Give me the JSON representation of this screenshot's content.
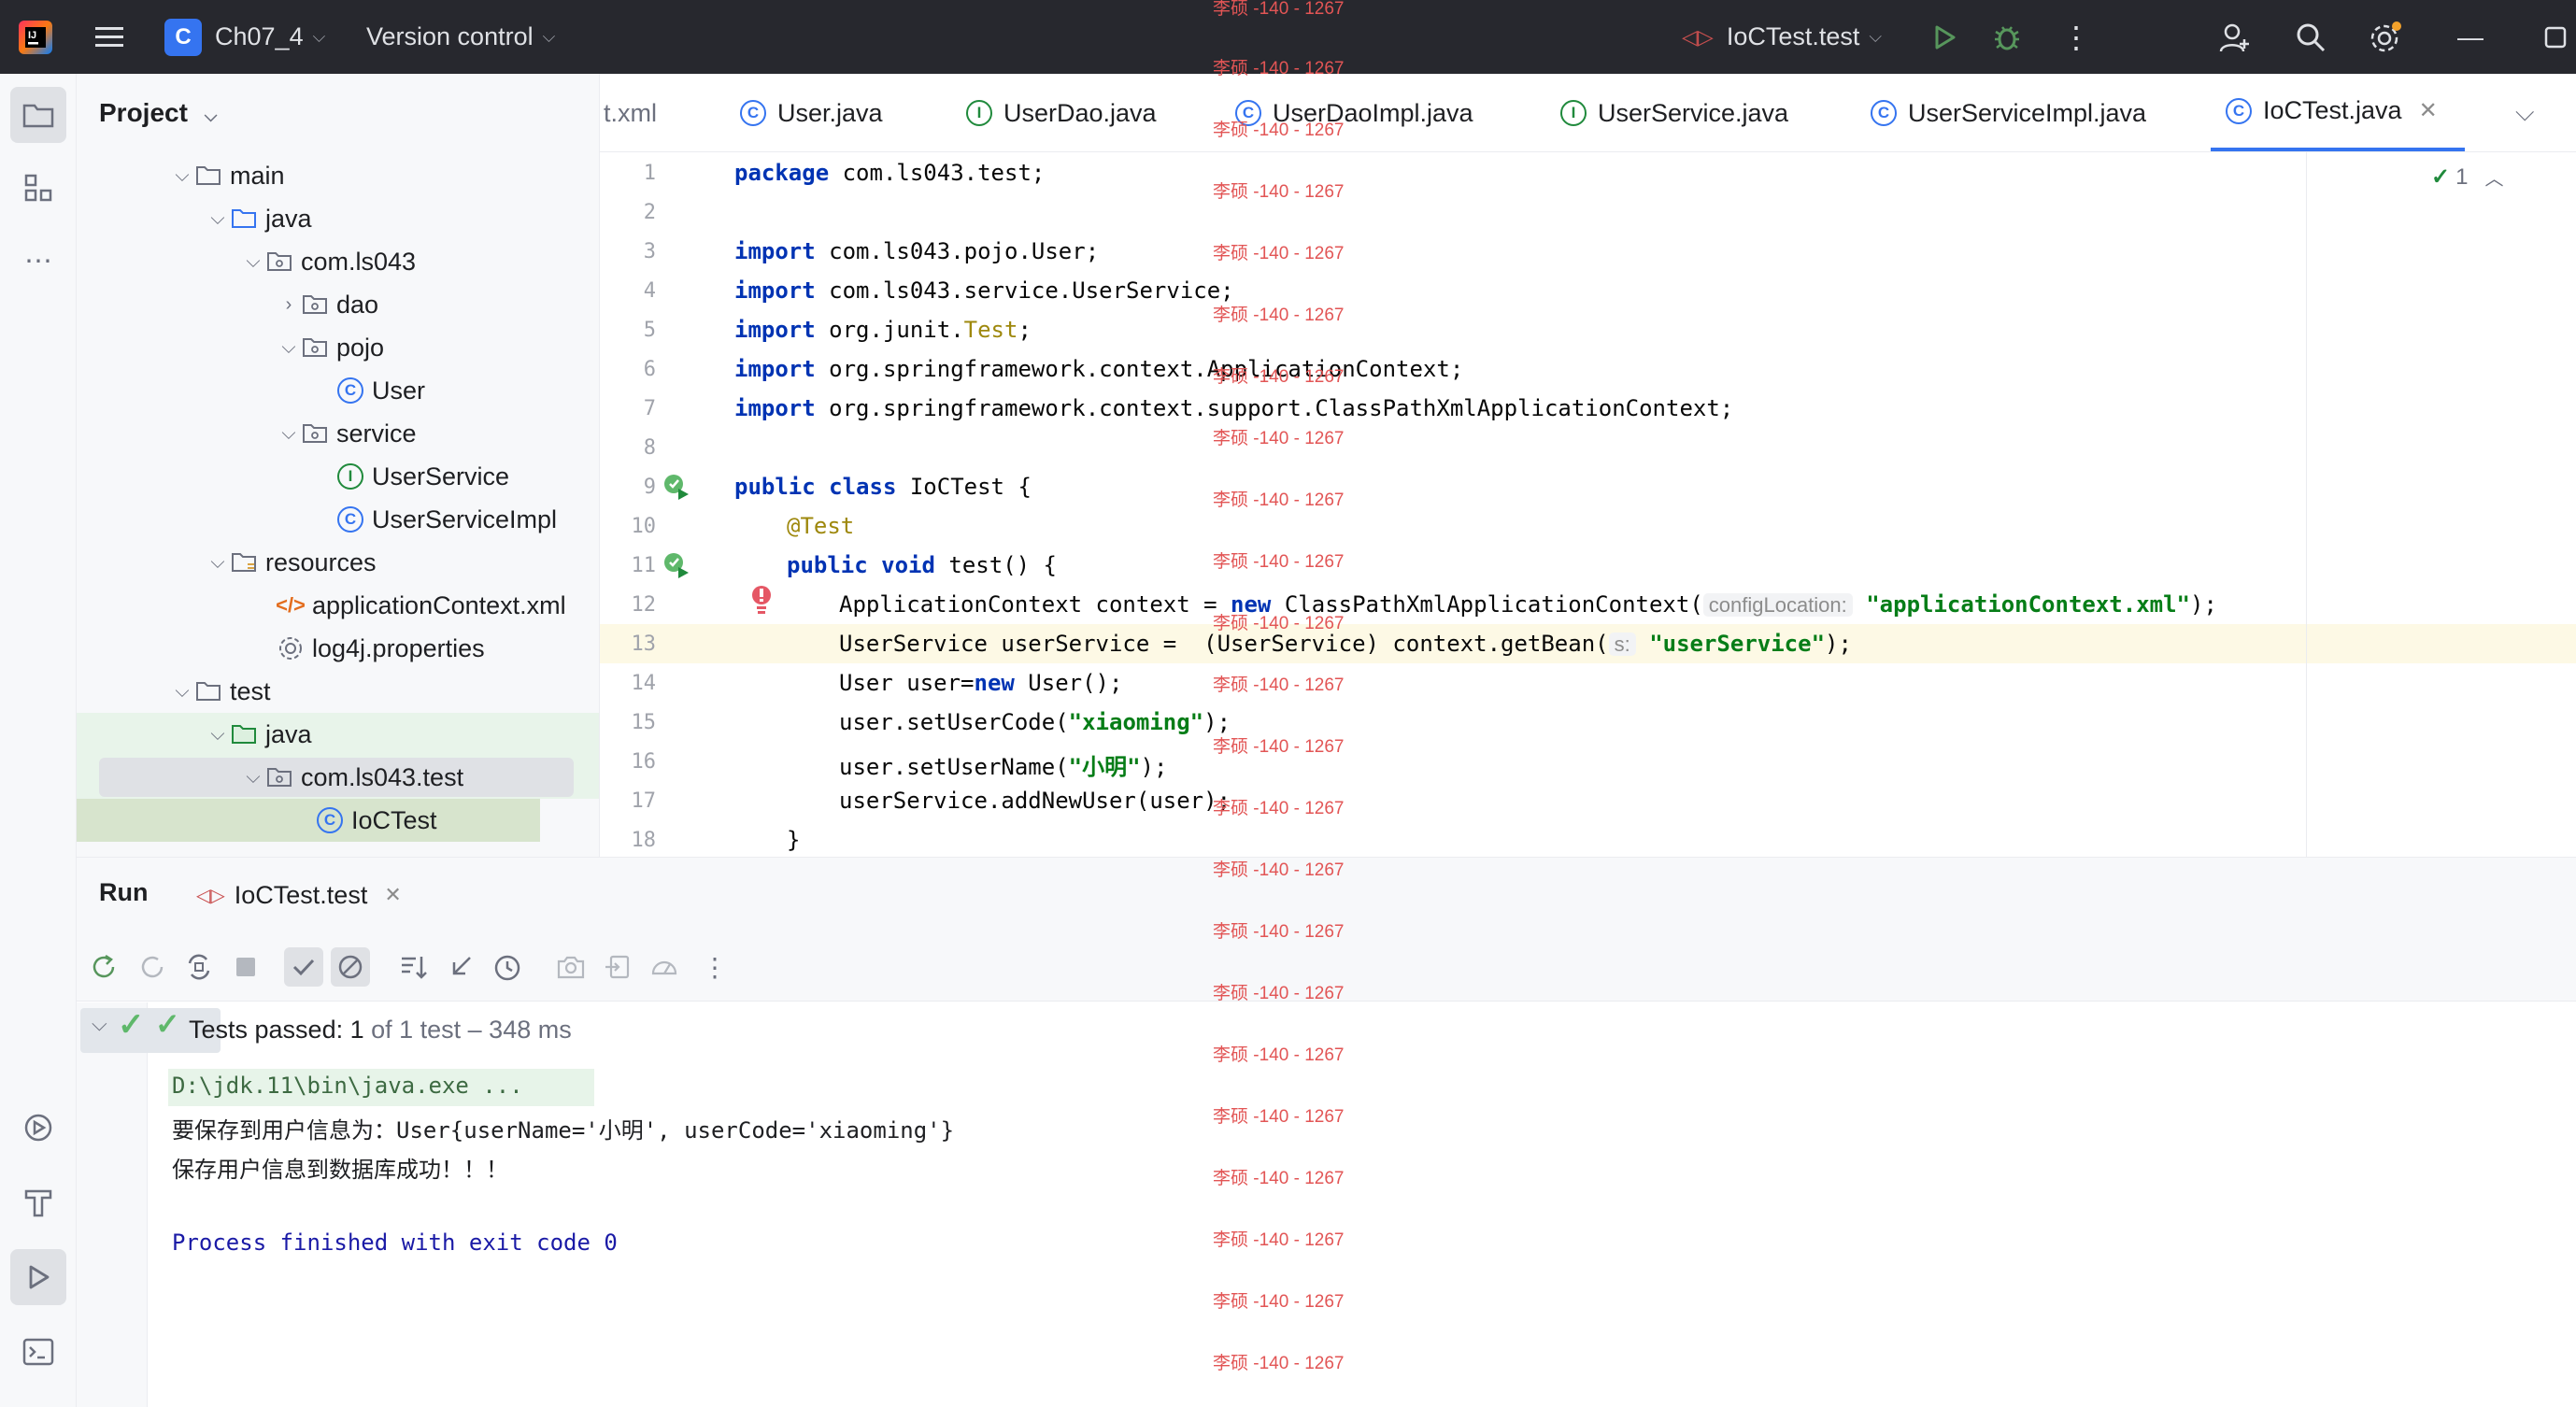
{
  "titlebar": {
    "project_badge": "C",
    "project_name": "Ch07_4",
    "vcs": "Version control",
    "run_config": "IoCTest.test"
  },
  "project_panel": {
    "title": "Project",
    "tree": [
      {
        "label": "main",
        "icon": "folder-icon"
      },
      {
        "label": "java",
        "icon": "source-folder-icon"
      },
      {
        "label": "com.ls043",
        "icon": "package-icon"
      },
      {
        "label": "dao",
        "icon": "package-icon"
      },
      {
        "label": "pojo",
        "icon": "package-icon"
      },
      {
        "label": "User",
        "icon": "class-icon"
      },
      {
        "label": "service",
        "icon": "package-icon"
      },
      {
        "label": "UserService",
        "icon": "interface-icon"
      },
      {
        "label": "UserServiceImpl",
        "icon": "class-icon"
      },
      {
        "label": "resources",
        "icon": "resources-folder-icon"
      },
      {
        "label": "applicationContext.xml",
        "icon": "xml-icon"
      },
      {
        "label": "log4j.properties",
        "icon": "properties-icon"
      },
      {
        "label": "test",
        "icon": "folder-icon"
      },
      {
        "label": "java",
        "icon": "test-source-folder-icon"
      },
      {
        "label": "com.ls043.test",
        "icon": "package-icon"
      },
      {
        "label": "IoCTest",
        "icon": "class-icon"
      }
    ]
  },
  "tabs": [
    {
      "label": "t.xml"
    },
    {
      "label": "User.java",
      "icon": "class-icon"
    },
    {
      "label": "UserDao.java",
      "icon": "interface-icon"
    },
    {
      "label": "UserDaoImpl.java",
      "icon": "class-icon"
    },
    {
      "label": "UserService.java",
      "icon": "interface-icon"
    },
    {
      "label": "UserServiceImpl.java",
      "icon": "class-icon"
    },
    {
      "label": "IoCTest.java",
      "icon": "class-icon",
      "active": true
    }
  ],
  "editor": {
    "line_numbers": [
      "1",
      "2",
      "3",
      "4",
      "5",
      "6",
      "7",
      "8",
      "9",
      "10",
      "11",
      "12",
      "13",
      "14",
      "15",
      "16",
      "17",
      "18"
    ],
    "current_line": "13",
    "inspection_count": "1",
    "code": {
      "l1_kw": "package",
      "l1_rest": " com.ls043.test;",
      "l3_kw": "import",
      "l3_rest": " com.ls043.pojo.User;",
      "l4_kw": "import",
      "l4_rest": " com.ls043.service.UserService;",
      "l5_kw": "import",
      "l5_rest": " org.junit.",
      "l5_cls": "Test",
      "l5_end": ";",
      "l6_kw": "import",
      "l6_rest": " org.springframework.context.ApplicationContext;",
      "l7_kw": "import",
      "l7_rest": " org.springframework.context.support.ClassPathXmlApplicationContext;",
      "l9_kw1": "public",
      "l9_kw2": "class",
      "l9_rest": " IoCTest {",
      "l10": "@Test",
      "l11_kw1": "public",
      "l11_kw2": "void",
      "l11_rest": " test() {",
      "l12_a": "ApplicationContext context = ",
      "l12_kw": "new",
      "l12_b": " ClassPathXmlApplicationContext(",
      "l12_hint": "configLocation:",
      "l12_str": "\"applicationContext.xml\"",
      "l12_end": ");",
      "l13_a": "UserService userService =  (UserService) context.getBean(",
      "l13_hint": "s:",
      "l13_str": "\"userService\"",
      "l13_end": ");",
      "l14_a": "User user=",
      "l14_kw": "new",
      "l14_b": " User();",
      "l15_a": "user.setUserCode(",
      "l15_str": "\"xiaoming\"",
      "l15_end": ");",
      "l16_a": "user.setUserName(",
      "l16_str": "\"小明\"",
      "l16_end": ");",
      "l17": "userService.addNewUser(user);",
      "l18": "}"
    }
  },
  "watermark": "李硕 -140 - 1267",
  "run_panel": {
    "title": "Run",
    "tab_label": "IoCTest.test",
    "result_prefix": "Tests passed: 1",
    "result_suffix": " of 1 test – 348 ms",
    "console": [
      "D:\\jdk.11\\bin\\java.exe ...",
      "要保存到用户信息为：User{userName='小明', userCode='xiaoming'}",
      "保存用户信息到数据库成功！！！",
      "",
      "Process finished with exit code 0"
    ]
  },
  "colors": {
    "accent": "#3574f0",
    "keyword": "#0033b3",
    "string": "#067d17",
    "annotation": "#9e880d",
    "success": "#208a3c",
    "watermark": "#e25555"
  }
}
